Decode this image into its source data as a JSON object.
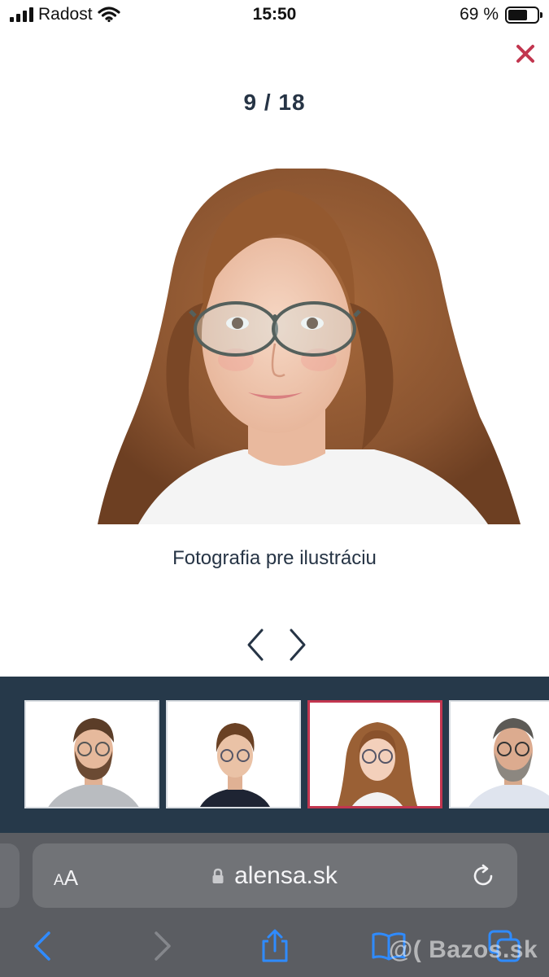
{
  "status_bar": {
    "carrier": "Radost",
    "time": "15:50",
    "battery": "69 %",
    "battery_level": 0.69
  },
  "lightbox": {
    "counter": "9 / 18",
    "caption": "Fotografia pre ilustráciu",
    "close_icon": "close-icon",
    "prev_icon": "chevron-left-icon",
    "next_icon": "chevron-right-icon",
    "accent_color": "#c2364f"
  },
  "thumbnails": [
    {
      "subject": "man-with-glasses",
      "active": false
    },
    {
      "subject": "boy-with-glasses",
      "active": false
    },
    {
      "subject": "girl-with-glasses",
      "active": true
    },
    {
      "subject": "older-man-with-glasses",
      "active": false
    }
  ],
  "browser": {
    "text_size_small": "A",
    "text_size_big": "A",
    "url": "alensa.sk",
    "toolbar": [
      "back-icon",
      "forward-icon",
      "share-icon",
      "bookmarks-icon",
      "tabs-icon"
    ]
  },
  "watermark": "@( Bazos.sk"
}
